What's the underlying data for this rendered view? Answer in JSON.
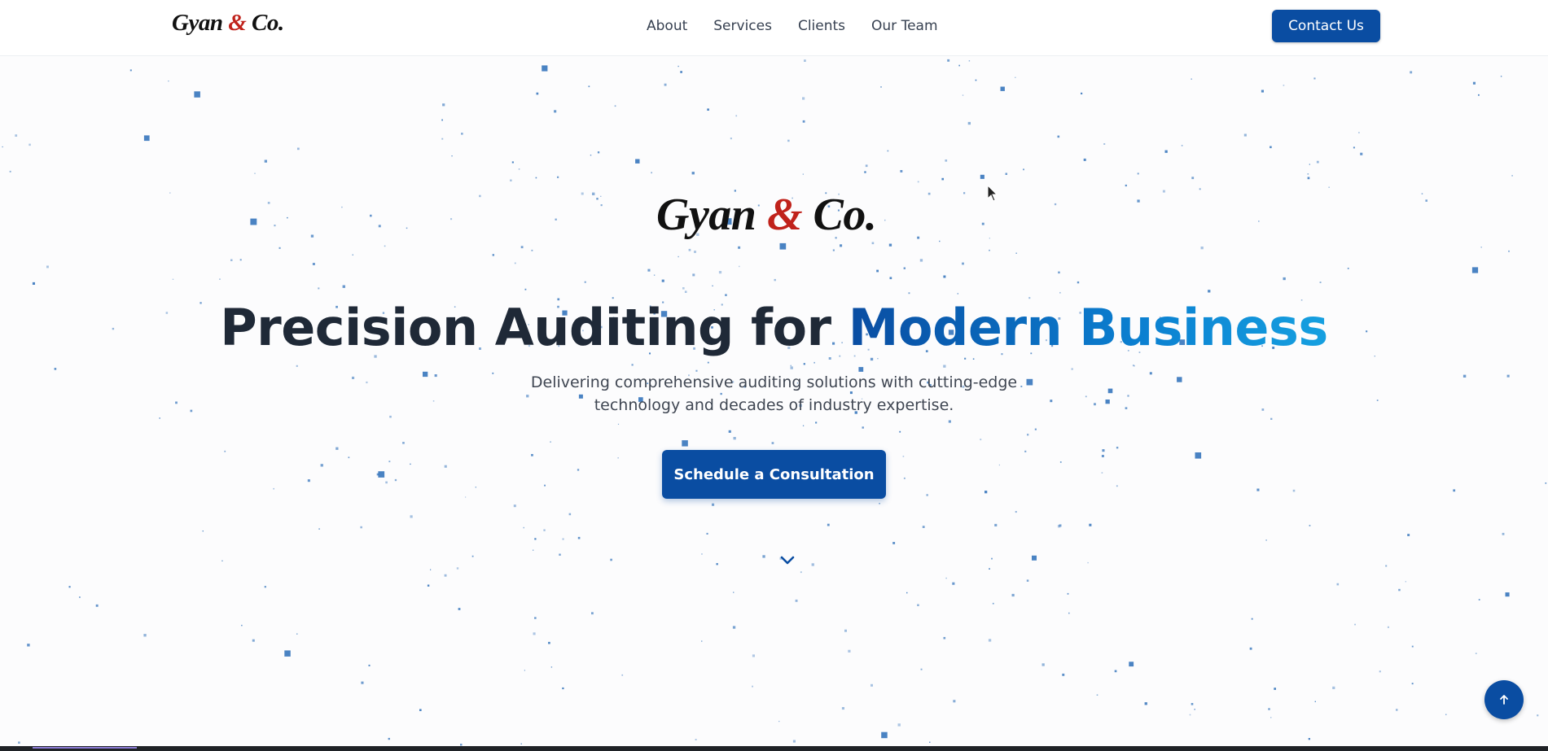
{
  "brand": {
    "name_part1": "Gyan",
    "ampersand": "&",
    "name_part2": "Co."
  },
  "nav": {
    "links": [
      "About",
      "Services",
      "Clients",
      "Our Team"
    ],
    "contact_label": "Contact Us"
  },
  "hero": {
    "headline_plain": "Precision Auditing for",
    "headline_accent": "Modern Business",
    "subtitle": "Delivering comprehensive auditing solutions with cutting-edge technology and decades of industry expertise.",
    "cta_label": "Schedule a Consultation"
  },
  "icons": {
    "scroll_down": "chevron-down-icon",
    "back_to_top": "arrow-up-icon"
  },
  "colors": {
    "primary": "#0a4da2",
    "accent_gradient_end": "#16a0e0",
    "logo_ampersand": "#c0221b",
    "particle": "#2a6db8"
  }
}
